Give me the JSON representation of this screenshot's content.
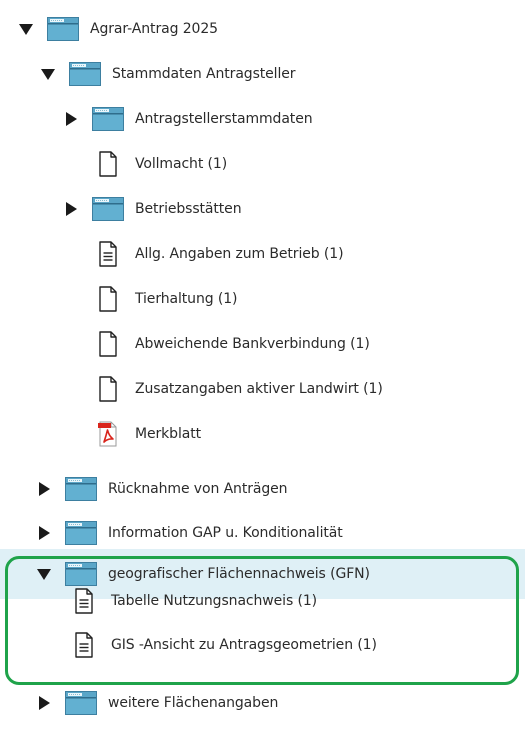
{
  "colors": {
    "folder": "#5aa6c8",
    "selection": "#dff0f6",
    "highlight_border": "#1fa34a",
    "pdf_red": "#d9251c"
  },
  "tree": {
    "root": {
      "label": "Agrar-Antrag 2025",
      "icon": "folder-icon",
      "expanded": true
    },
    "stammdaten": {
      "label": "Stammdaten Antragsteller",
      "icon": "folder-icon",
      "expanded": true
    },
    "antragsteller": {
      "label": "Antragstellerstammdaten",
      "icon": "folder-icon",
      "expanded": false
    },
    "vollmacht": {
      "label": "Vollmacht (1)",
      "icon": "blank-document-icon"
    },
    "betriebsstaetten": {
      "label": "Betriebsstätten",
      "icon": "folder-icon",
      "expanded": false
    },
    "allg_angaben": {
      "label": "Allg. Angaben zum Betrieb (1)",
      "icon": "text-document-icon"
    },
    "tierhaltung": {
      "label": "Tierhaltung (1)",
      "icon": "blank-document-icon"
    },
    "bankverbindung": {
      "label": "Abweichende Bankverbindung (1)",
      "icon": "blank-document-icon"
    },
    "zusatzangaben": {
      "label": "Zusatzangaben aktiver Landwirt (1)",
      "icon": "blank-document-icon"
    },
    "merkblatt": {
      "label": "Merkblatt",
      "icon": "pdf-icon"
    },
    "ruecknahme": {
      "label": "Rücknahme von Anträgen",
      "icon": "folder-icon",
      "expanded": false
    },
    "information_gap": {
      "label": "Information GAP u. Konditionalität",
      "icon": "folder-icon",
      "expanded": false
    },
    "gfn": {
      "label": "geografischer Flächennachweis (GFN)",
      "icon": "folder-icon",
      "expanded": true,
      "selected": true
    },
    "tabelle_nutzung": {
      "label": "Tabelle Nutzungsnachweis (1)",
      "icon": "text-document-icon"
    },
    "gis_ansicht": {
      "label": "GIS -Ansicht zu Antragsgeometrien (1)",
      "icon": "text-document-icon"
    },
    "weitere": {
      "label": "weitere Flächenangaben",
      "icon": "folder-icon",
      "expanded": false
    }
  }
}
